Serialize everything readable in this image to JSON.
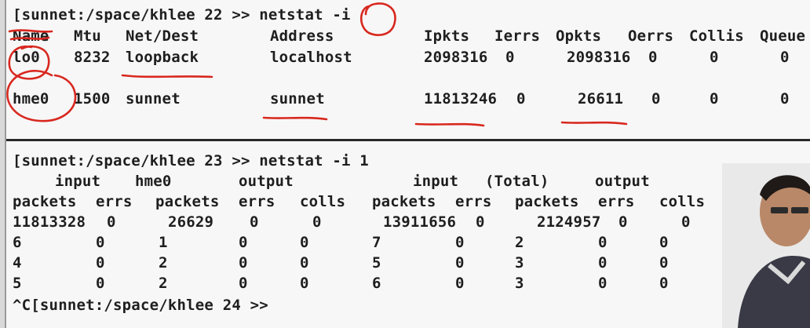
{
  "session1": {
    "command_line": "[sunnet:/space/khlee 22 >> netstat -i",
    "headers": [
      "Name",
      "Mtu",
      "Net/Dest",
      "Address",
      "Ipkts",
      "Ierrs",
      "Opkts",
      "Oerrs",
      "Collis",
      "Queue"
    ],
    "rows": [
      [
        "lo0",
        "8232",
        "loopback",
        "localhost",
        "2098316",
        "0",
        "2098316",
        "0",
        "0",
        "0"
      ],
      [
        "hme0",
        "1500",
        "sunnet",
        "sunnet",
        "11813246",
        "0",
        "26611",
        "0",
        "0",
        "0"
      ]
    ]
  },
  "session2": {
    "command_line": "[sunnet:/space/khlee 23 >> netstat -i 1",
    "group_header": [
      "input",
      "hme0",
      "output",
      "input",
      "(Total)",
      "output"
    ],
    "col_headers": [
      "packets",
      "errs",
      "packets",
      "errs",
      "colls",
      "packets",
      "errs",
      "packets",
      "errs",
      "colls"
    ],
    "rows": [
      [
        "11813328",
        "0",
        "26629",
        "0",
        "0",
        "13911656",
        "0",
        "2124957",
        "0",
        "0"
      ],
      [
        "6",
        "0",
        "1",
        "0",
        "0",
        "7",
        "0",
        "2",
        "0",
        "0"
      ],
      [
        "4",
        "0",
        "2",
        "0",
        "0",
        "5",
        "0",
        "3",
        "0",
        "0"
      ],
      [
        "5",
        "0",
        "2",
        "0",
        "0",
        "6",
        "0",
        "3",
        "0",
        "0"
      ]
    ],
    "prompt_line": "^C[sunnet:/space/khlee 24 >>"
  },
  "colors": {
    "terminal_bg": "#f7f7f7",
    "text": "#1e1e1e",
    "annotation_ink": "#d8281f",
    "divider": "#2a2a2a"
  }
}
